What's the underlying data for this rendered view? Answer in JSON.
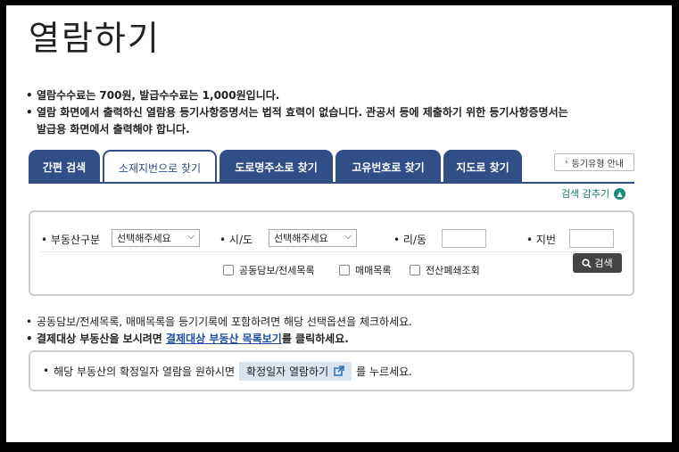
{
  "page": {
    "title": "열람하기"
  },
  "notices": [
    "열람수수료는 700원, 발급수수료는 1,000원입니다.",
    "열람 화면에서 출력하신 열람용 등기사항증명서는 법적 효력이 없습니다. 관공서 등에 제출하기 위한 등기사항증명서는",
    "발급용 화면에서 출력해야 합니다."
  ],
  "tabs": [
    {
      "label": "간편 검색"
    },
    {
      "label": "소재지번으로 찾기"
    },
    {
      "label": "도로명주소로 찾기"
    },
    {
      "label": "고유번호로 찾기"
    },
    {
      "label": "지도로 찾기"
    }
  ],
  "type_guide_button": {
    "label": "등기유형 안내"
  },
  "collapse_toggle": {
    "label": "검색 감추기"
  },
  "search_form": {
    "property_type": {
      "label": "부동산구분",
      "value": "선택해주세요"
    },
    "province": {
      "label": "시/도",
      "value": "선택해주세요"
    },
    "village": {
      "label": "리/동",
      "value": ""
    },
    "lot": {
      "label": "지번",
      "value": ""
    },
    "checkboxes": [
      {
        "label": "공동담보/전세목록",
        "checked": false
      },
      {
        "label": "매매목록",
        "checked": false
      },
      {
        "label": "전산폐쇄조회",
        "checked": false
      }
    ],
    "search_button": {
      "label": "검색"
    }
  },
  "info": {
    "line1": "공동담보/전세목록, 매매목록을 등기기록에 포함하려면 해당 선택옵션을 체크하세요.",
    "line2_prefix": "결제대상 부동산을 보시려면 ",
    "line2_link": "결제대상 부동산 목록보기",
    "line2_suffix": "를 클릭하세요."
  },
  "confirm_box": {
    "prefix": "해당 부동산의 확정일자 열람을 원하시면",
    "button": "확정일자 열람하기",
    "suffix": "를 누르세요."
  },
  "colors": {
    "tab_blue": "#2f4f86",
    "accent_teal": "#1a8c7e",
    "link": "#1e4fa3"
  }
}
